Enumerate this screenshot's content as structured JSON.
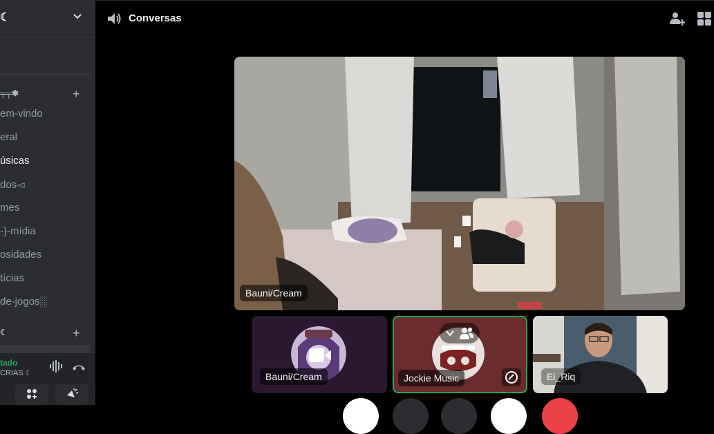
{
  "server": {
    "name": "☾"
  },
  "categories": {
    "first": {
      "label": "╤╤✱"
    },
    "second": {
      "label": "☾"
    }
  },
  "channels": [
    {
      "label": "em-vindo",
      "active": false
    },
    {
      "label": "eral",
      "active": false
    },
    {
      "label": "úsicas",
      "active": true
    },
    {
      "label": "dos◅",
      "active": false
    },
    {
      "label": "mes",
      "active": false
    },
    {
      "label": "-}-mídia",
      "active": false
    },
    {
      "label": "osidades",
      "active": false
    },
    {
      "label": "tícias",
      "active": false
    },
    {
      "label": "de-jogos░",
      "active": false
    }
  ],
  "voice_panel": {
    "status": "tado",
    "channel": "CRIAS ☾"
  },
  "header": {
    "title": "Conversas"
  },
  "participants": {
    "main": {
      "name": "Bauni/Cream"
    },
    "tiles": [
      {
        "name": "Bauni/Cream"
      },
      {
        "name": "Jockie Music"
      },
      {
        "name": "Ei_Riq"
      }
    ]
  },
  "icons": {
    "speaker": "speaker-icon",
    "add_friend": "add-friend-icon",
    "grid": "grid-icon",
    "camera": "camera-icon",
    "chevron": "chevron-down-icon",
    "people": "people-icon",
    "hangup": "hangup-icon",
    "soundboard": "soundboard-icon",
    "activity": "activity-icon",
    "waveform": "waveform-icon"
  },
  "colors": {
    "sidebar_bg": "#2b2d31",
    "connected_green": "#23a55a",
    "speaking_border": "#23a55a",
    "hangup_red": "#ed4245"
  }
}
